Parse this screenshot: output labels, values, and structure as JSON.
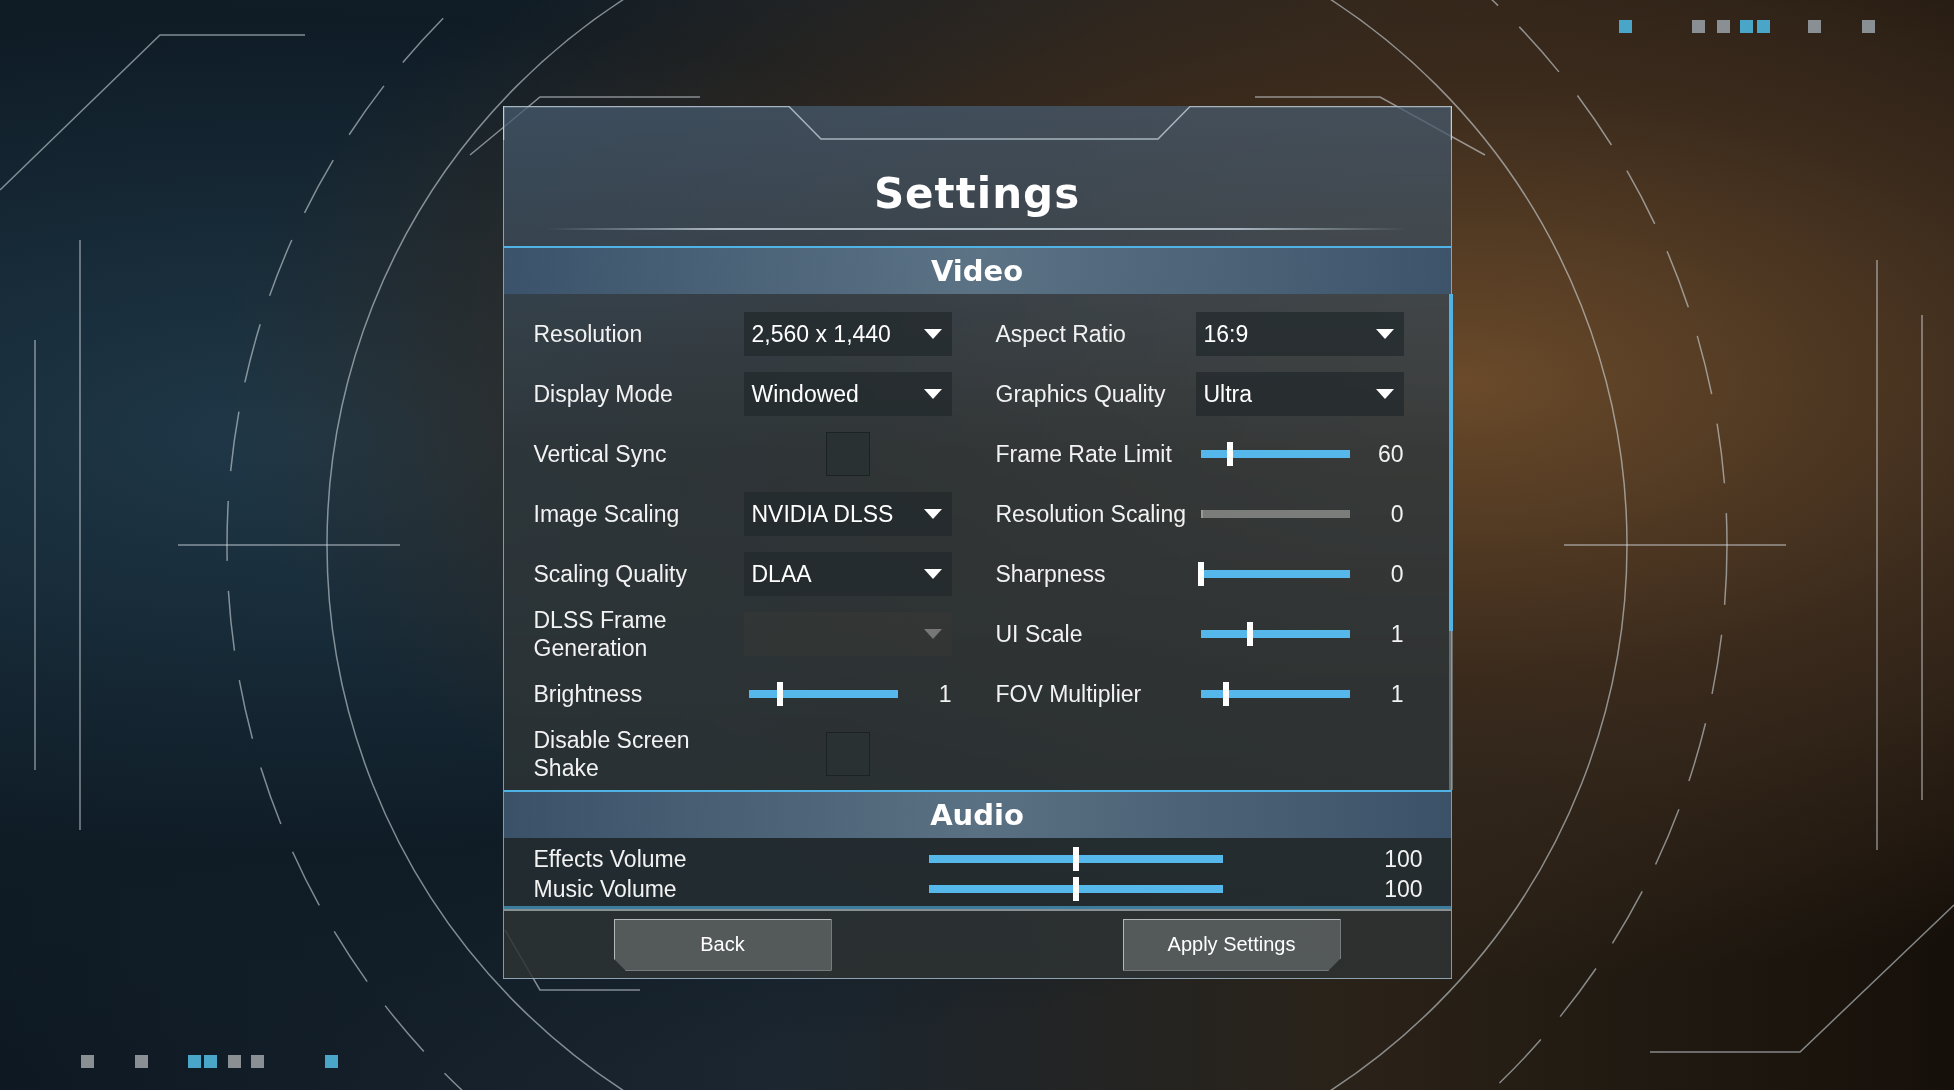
{
  "title": "Settings",
  "video": {
    "heading": "Video",
    "rows": [
      {
        "left": {
          "kind": "dropdown",
          "label": "Resolution",
          "value": "2,560 x 1,440",
          "disabled": false
        },
        "right": {
          "kind": "dropdown",
          "label": "Aspect Ratio",
          "value": "16:9",
          "disabled": false
        }
      },
      {
        "left": {
          "kind": "dropdown",
          "label": "Display Mode",
          "value": "Windowed",
          "disabled": false
        },
        "right": {
          "kind": "dropdown",
          "label": "Graphics Quality",
          "value": "Ultra",
          "disabled": false
        }
      },
      {
        "left": {
          "kind": "checkbox",
          "label": "Vertical Sync",
          "checked": false
        },
        "right": {
          "kind": "slider",
          "label": "Frame Rate Limit",
          "level": 0.2,
          "reading": "60",
          "disabled": false
        }
      },
      {
        "left": {
          "kind": "dropdown",
          "label": "Image Scaling",
          "value": "NVIDIA DLSS",
          "disabled": false
        },
        "right": {
          "kind": "slider",
          "label": "Resolution Scaling",
          "level": 0,
          "reading": "0",
          "disabled": true
        }
      },
      {
        "left": {
          "kind": "dropdown",
          "label": "Scaling Quality",
          "value": "DLAA",
          "disabled": false
        },
        "right": {
          "kind": "slider",
          "label": "Sharpness",
          "level": 0,
          "reading": "0",
          "disabled": false
        }
      },
      {
        "left": {
          "kind": "dropdown",
          "label": "DLSS Frame Generation",
          "disabled": true
        },
        "right": {
          "kind": "slider",
          "label": "UI Scale",
          "level": 0.33,
          "reading": "1",
          "disabled": false
        }
      },
      {
        "left": {
          "kind": "slider",
          "label": "Brightness",
          "level": 0.21,
          "reading": "1",
          "disabled": false
        },
        "right": {
          "kind": "slider",
          "label": "FOV Multiplier",
          "level": 0.17,
          "reading": "1",
          "disabled": false
        }
      },
      {
        "left": {
          "kind": "checkbox",
          "label": "Disable Screen Shake",
          "checked": false
        }
      }
    ]
  },
  "audio": {
    "heading": "Audio",
    "rows": [
      {
        "label": "Effects Volume",
        "level": 0.5,
        "reading": "100"
      },
      {
        "label": "Music Volume",
        "level": 0.5,
        "reading": "100"
      }
    ]
  },
  "buttons": [
    {
      "label": "Back"
    },
    {
      "label": "Apply Settings"
    }
  ]
}
